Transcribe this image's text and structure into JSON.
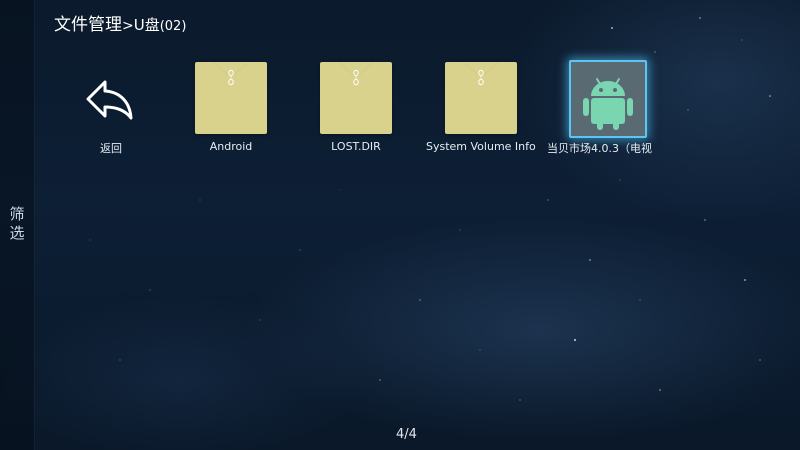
{
  "header": {
    "title_main": "文件管理",
    "title_sep": ">",
    "location": "U盘",
    "count": "(02)"
  },
  "sidebar": {
    "filter_label": "筛选"
  },
  "items": [
    {
      "label": "返回",
      "icon": "back-arrow-icon",
      "type": "back"
    },
    {
      "label": "Android",
      "icon": "folder-icon",
      "type": "folder"
    },
    {
      "label": "LOST.DIR",
      "icon": "folder-icon",
      "type": "folder"
    },
    {
      "label": "System Volume Infor",
      "icon": "folder-icon",
      "type": "folder"
    },
    {
      "label": "当贝市场4.0.3（电视",
      "icon": "android-icon",
      "type": "apk",
      "selected": true
    }
  ],
  "pagination": {
    "label": "4/4"
  },
  "colors": {
    "folder": "#d9d28c",
    "folder_clip": "#ffffff",
    "android_green": "#79d6b0",
    "focus_glow": "#5cc6f2",
    "background": "#0d1f35"
  }
}
